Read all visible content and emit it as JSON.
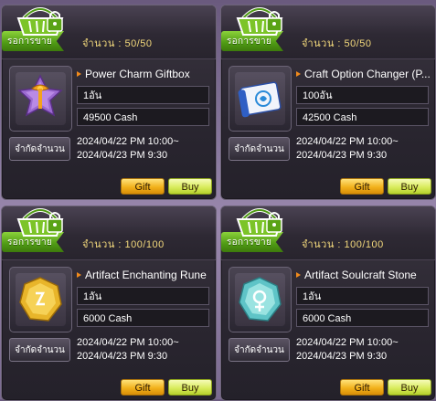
{
  "ribbon_label": "รอการขาย",
  "limit_button_label": "จำกัดจำนวน",
  "gift_label": "Gift",
  "buy_label": "Buy",
  "cards": [
    {
      "quantity": "จำนวน :  50/50",
      "name": "Power Charm Giftbox",
      "amount": "1อัน",
      "price": "49500 Cash",
      "date_start": "2024/04/22 PM 10:00~",
      "date_end": "2024/04/23 PM 9:30",
      "icon": "purple-giftbox-icon"
    },
    {
      "quantity": "จำนวน :  50/50",
      "name": "Craft Option Changer (P...",
      "amount": "100อัน",
      "price": "42500 Cash",
      "date_start": "2024/04/22 PM 10:00~",
      "date_end": "2024/04/23 PM 9:30",
      "icon": "blue-scroll-icon"
    },
    {
      "quantity": "จำนวน :  100/100",
      "name": "Artifact Enchanting Rune",
      "amount": "1อัน",
      "price": "6000 Cash",
      "date_start": "2024/04/22 PM 10:00~",
      "date_end": "2024/04/23 PM 9:30",
      "icon": "gold-rune-icon"
    },
    {
      "quantity": "จำนวน :  100/100",
      "name": "Artifact Soulcraft Stone",
      "amount": "1อัน",
      "price": "6000 Cash",
      "date_start": "2024/04/22 PM 10:00~",
      "date_end": "2024/04/23 PM 9:30",
      "icon": "cyan-stone-icon"
    }
  ],
  "colors": {
    "ribbon_green": "#4f9a14",
    "quantity_gold": "#f3d97c",
    "gift_orange": "#f2b21c",
    "buy_lime": "#d9ec5e"
  }
}
